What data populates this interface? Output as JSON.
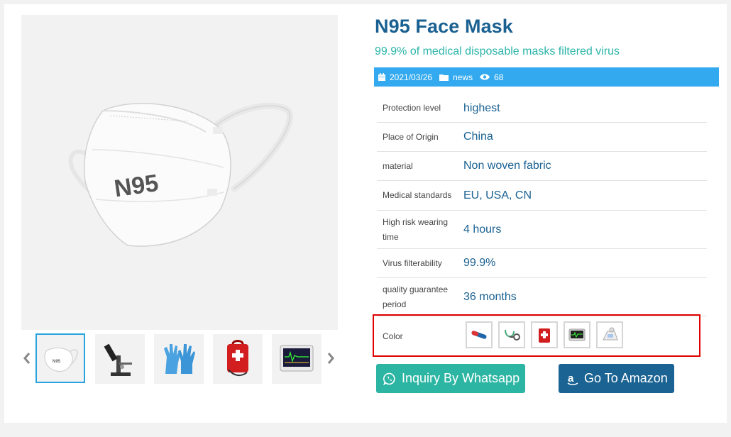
{
  "product": {
    "title": "N95 Face Mask",
    "subtitle": "99.9% of medical disposable masks filtered virus",
    "mask_print": "N95"
  },
  "meta": {
    "date": "2021/03/26",
    "category": "news",
    "views": "68",
    "bar_color": "#33aaf0"
  },
  "specs": [
    {
      "label": "Protection level",
      "value": "highest"
    },
    {
      "label": "Place of Origin",
      "value": "China"
    },
    {
      "label": "material",
      "value": "Non woven fabric"
    },
    {
      "label": "Medical standards",
      "value": "EU, USA, CN"
    },
    {
      "label": "High risk wearing time",
      "value": "4 hours"
    },
    {
      "label": "Virus filterability",
      "value": "99.9%"
    },
    {
      "label": "quality guarantee period",
      "value": "36 months"
    }
  ],
  "color": {
    "label": "Color",
    "swatches": [
      "thermometer",
      "stethoscope",
      "first-aid-kit",
      "patient-monitor",
      "pump"
    ]
  },
  "gallery": {
    "thumbnails": [
      "n95-mask",
      "microscope",
      "gloves",
      "first-aid-bag",
      "patient-monitor"
    ],
    "active_index": 0
  },
  "buttons": {
    "whatsapp": "Inquiry By Whatsapp",
    "amazon": "Go To Amazon"
  },
  "colors": {
    "title": "#1a6192",
    "subtitle": "#2ab4a9",
    "whatsapp": "#2cb5a3",
    "amazon": "#1b6392",
    "highlight": "#e00000"
  }
}
